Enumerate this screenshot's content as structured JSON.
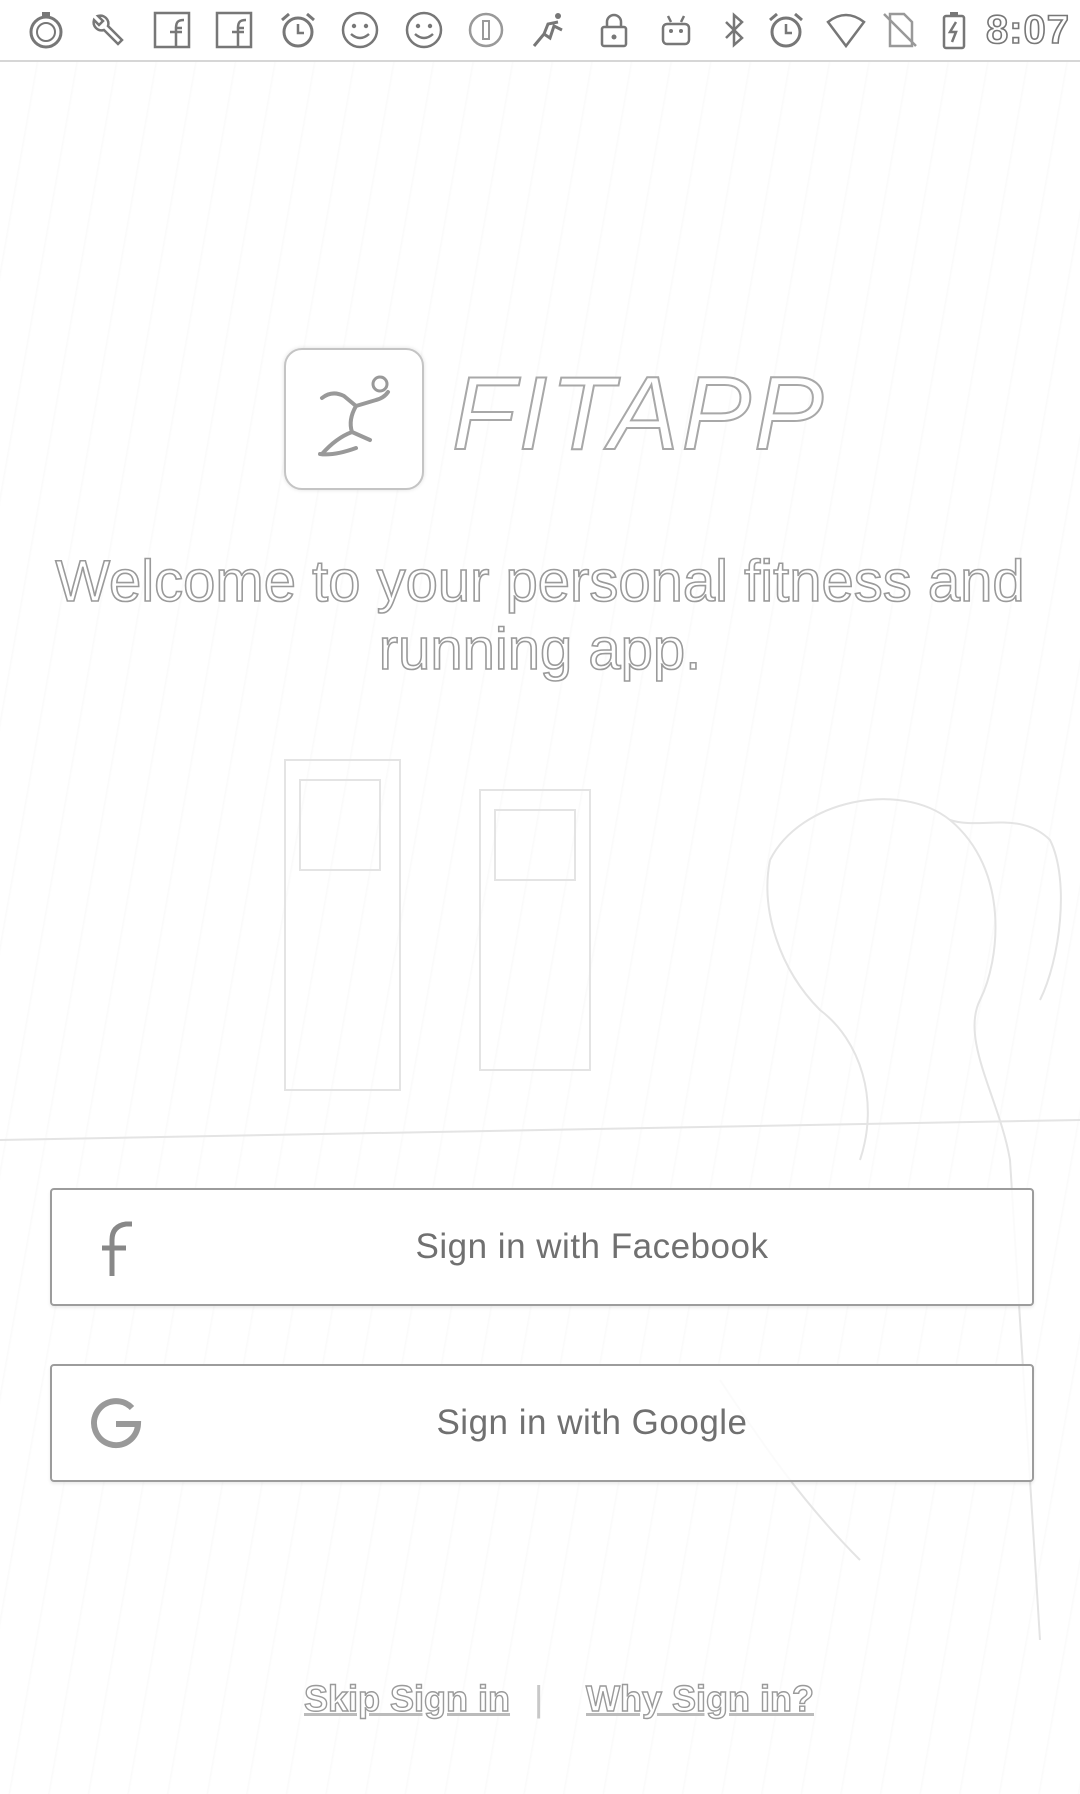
{
  "status_bar": {
    "time": "8:07",
    "icons": [
      "stopwatch-icon",
      "wrench-icon",
      "facebook-icon",
      "facebook-icon",
      "alarm-icon",
      "smiley-icon",
      "smiley-icon",
      "circle-info-icon",
      "runner-icon",
      "lock-icon",
      "android-icon",
      "bluetooth-icon",
      "alarm-icon",
      "wifi-icon",
      "no-sim-icon",
      "battery-charging-icon"
    ]
  },
  "logo": {
    "text": "FITAPP"
  },
  "welcome_text": "Welcome to your personal fitness and running app.",
  "buttons": {
    "facebook_label": "Sign in with Facebook",
    "google_label": "Sign in with Google"
  },
  "footer": {
    "skip_label": "Skip Sign in",
    "separator": "|",
    "why_label": "Why Sign in?"
  }
}
